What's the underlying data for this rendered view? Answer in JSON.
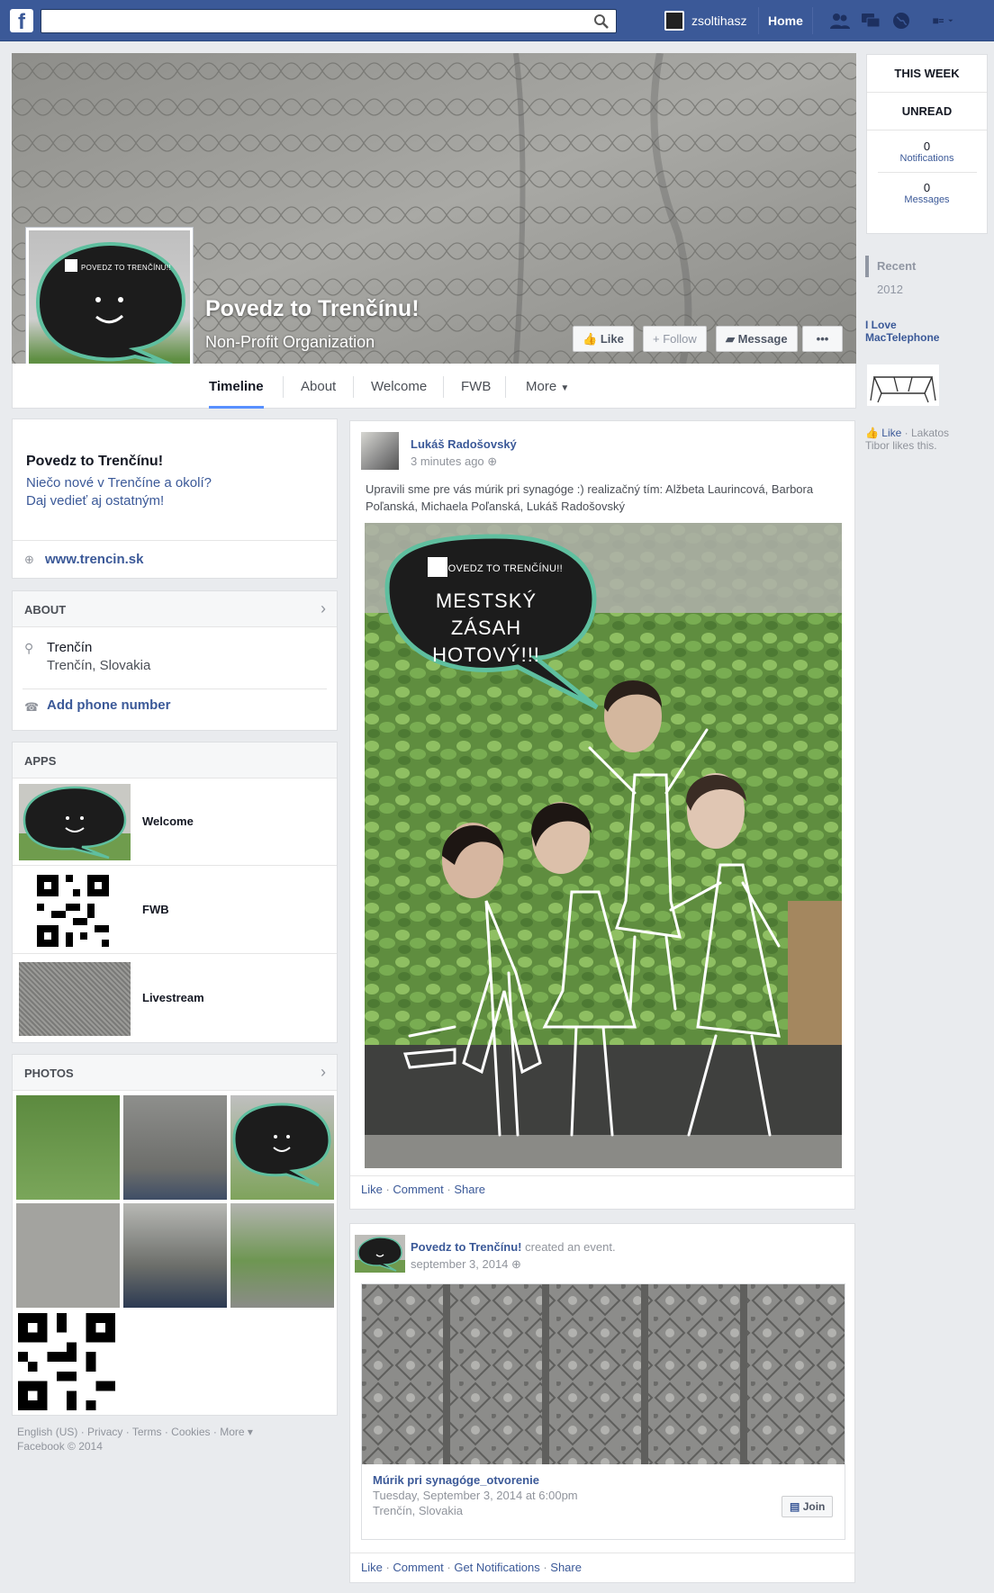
{
  "topbar": {
    "logo": "f",
    "search_placeholder": "",
    "user_name": "zsoltihasz",
    "home_label": "Home",
    "icons": [
      "friend-requests-icon",
      "messages-icon",
      "notifications-icon",
      "account-menu-icon"
    ]
  },
  "page": {
    "name": "Povedz to Trenčínu!",
    "category": "Non-Profit Organization",
    "buttons": {
      "like": "Like",
      "follow": "Follow",
      "message": "Message",
      "more": "•••"
    },
    "tabs": [
      "Timeline",
      "About",
      "Welcome",
      "FWB",
      "More"
    ]
  },
  "rail": {
    "this_week": "THIS WEEK",
    "unread": "UNREAD",
    "notifications_count": "0",
    "notifications_label": "Notifications",
    "messages_count": "0",
    "messages_label": "Messages",
    "recent": "Recent",
    "year": "2012",
    "ad_title": "I Love MacTelephone",
    "like_label": "Like",
    "like_text": "· Lakatos Tibor likes this."
  },
  "intro": {
    "title": "Povedz to Trenčínu!",
    "line1": "Niečo nové v Trenčíne a okolí?",
    "line2": "Daj vedieť aj ostatným!",
    "website": "www.trencin.sk"
  },
  "about": {
    "heading": "ABOUT",
    "city": "Trenčín",
    "region": "Trenčín, Slovakia",
    "add_phone": "Add phone number"
  },
  "apps": {
    "heading": "APPS",
    "items": [
      {
        "label": "Welcome"
      },
      {
        "label": "FWB"
      },
      {
        "label": "Livestream"
      }
    ]
  },
  "photos": {
    "heading": "PHOTOS"
  },
  "footer": {
    "links": [
      "English (US)",
      "Privacy",
      "Terms",
      "Cookies",
      "More"
    ],
    "copyright": "Facebook © 2014"
  },
  "post1": {
    "author": "Lukáš Radošovský",
    "time": "3 minutes ago",
    "text": "Upravili sme pre vás múrik pri synagóge :) realizačný tím: Alžbeta Laurincová, Barbora Poľanská, Michaela Poľanská, Lukáš Radošovský",
    "bubble_small": "POVEDZ TO TRENČÍNU!!",
    "bubble_big1": "MESTSKÝ ZÁSAH",
    "bubble_big2": "HOTOVÝ!!!",
    "actions": [
      "Like",
      "Comment",
      "Share"
    ]
  },
  "post2": {
    "author": "Povedz to Trenčínu!",
    "action": "created an event.",
    "time": "september 3, 2014",
    "event_title": "Múrik pri synagóge_otvorenie",
    "event_time": "Tuesday, September 3, 2014 at 6:00pm",
    "event_place": "Trenčín, Slovakia",
    "join": "Join",
    "actions": [
      "Like",
      "Comment",
      "Get Notifications",
      "Share"
    ]
  },
  "profile_bubble": "POVEDZ TO TRENČÍNU!!",
  "colors": {
    "brand": "#3b5998",
    "bubble": "#1c1c1c",
    "bubble_border": "#5fbf9f"
  }
}
